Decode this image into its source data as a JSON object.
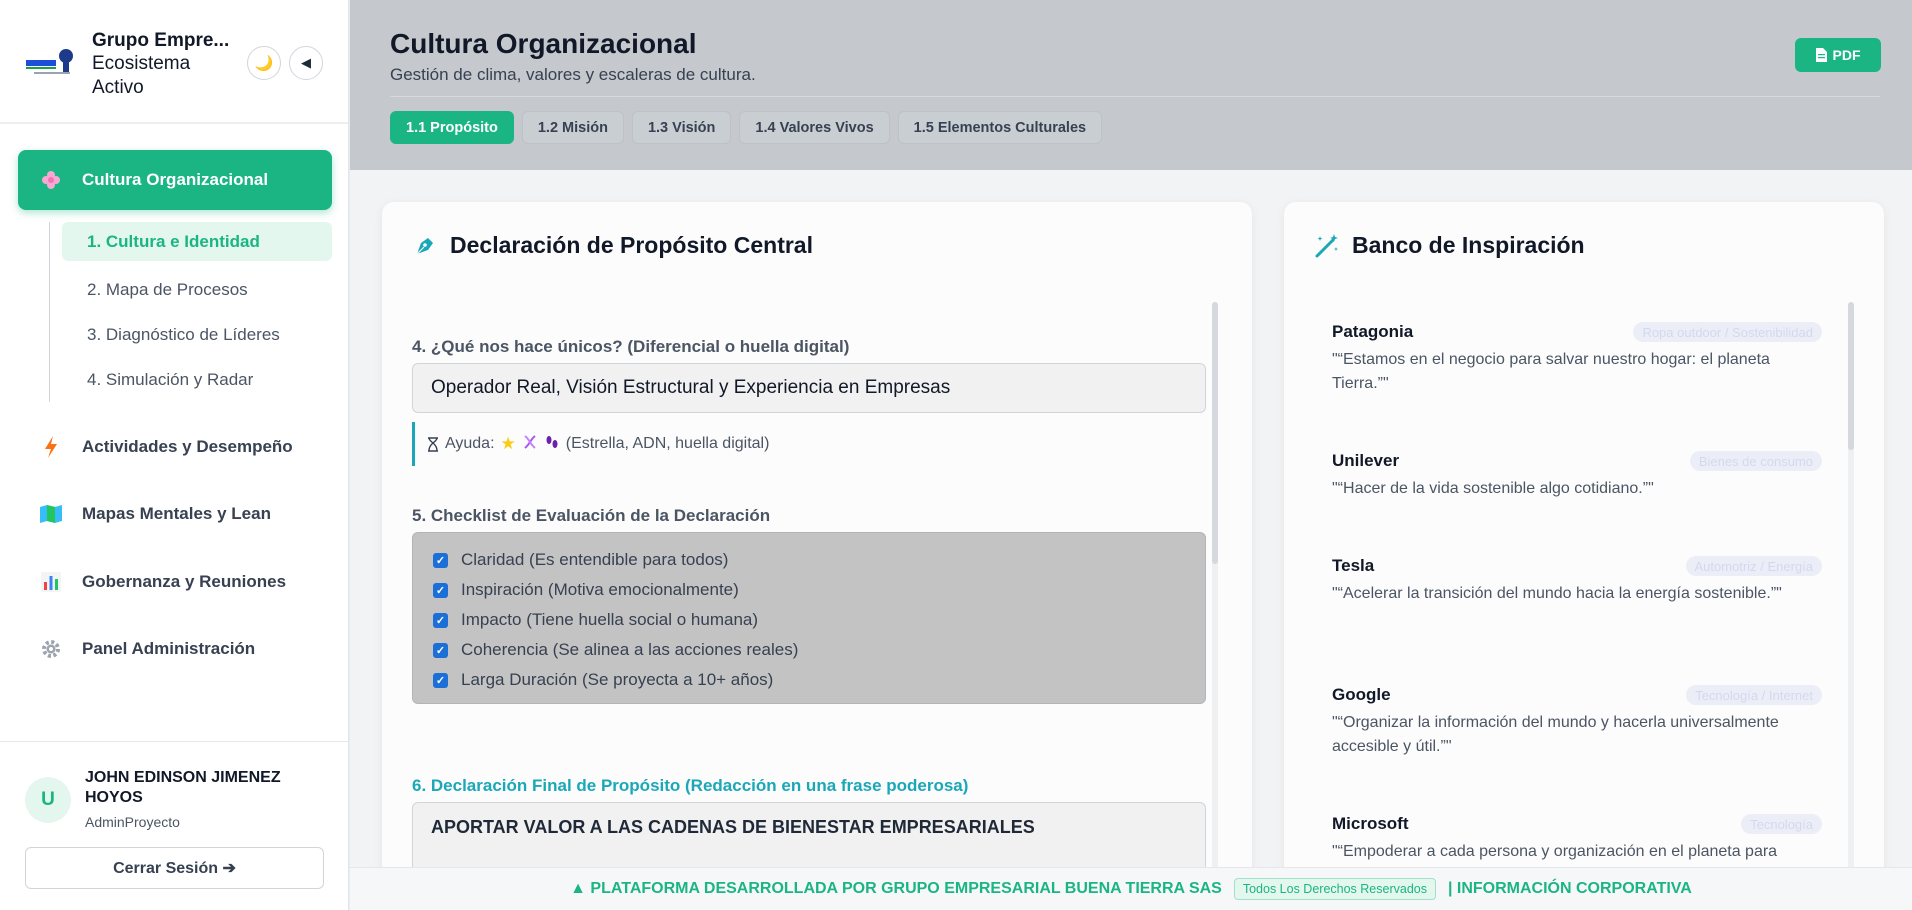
{
  "sidebar": {
    "brand_title": "Grupo Empre...",
    "brand_subtitle": "Ecosistema Activo",
    "theme_icon": "🌙",
    "collapse_icon": "◀",
    "main_item": "Cultura Organizacional",
    "sub_items": [
      "1. Cultura e Identidad",
      "2. Mapa de Procesos",
      "3. Diagnóstico de Líderes",
      "4. Simulación y Radar"
    ],
    "items": [
      {
        "label": "Actividades y Desempeño",
        "icon": "⚡"
      },
      {
        "label": "Mapas Mentales y Lean",
        "icon": "🗺"
      },
      {
        "label": "Gobernanza y Reuniones",
        "icon": "📊"
      },
      {
        "label": "Panel Administración",
        "icon": "⚙"
      }
    ],
    "user": {
      "initial": "U",
      "name": "JOHN EDINSON JIMENEZ HOYOS",
      "role": "AdminProyecto",
      "logout": "Cerrar Sesión ➔"
    }
  },
  "header": {
    "title": "Cultura Organizacional",
    "subtitle": "Gestión de clima, valores y escaleras de cultura.",
    "pdf_label": "PDF",
    "tabs": [
      "1.1 Propósito",
      "1.2 Misión",
      "1.3 Visión",
      "1.4 Valores Vivos",
      "1.5 Elementos Culturales"
    ]
  },
  "purpose": {
    "title": "Declaración de Propósito Central",
    "q4_label": "4. ¿Qué nos hace únicos? (Diferencial o huella digital)",
    "q4_value": "Operador Real, Visión Estructural y Experiencia en Empresas",
    "help_prefix": "Ayuda:",
    "help_text": "(Estrella, ADN, huella digital)",
    "q5_label": "5. Checklist de Evaluación de la Declaración",
    "checklist": [
      "Claridad (Es entendible para todos)",
      "Inspiración (Motiva emocionalmente)",
      "Impacto (Tiene huella social o humana)",
      "Coherencia (Se alinea a las acciones reales)",
      "Larga Duración (Se proyecta a 10+ años)"
    ],
    "q6_label": "6. Declaración Final de Propósito (Redacción en una frase poderosa)",
    "q6_value": "APORTAR VALOR A LAS CADENAS DE BIENESTAR EMPRESARIALES"
  },
  "inspiration": {
    "title": "Banco de Inspiración",
    "items": [
      {
        "name": "Patagonia",
        "tag": "Ropa outdoor / Sostenibilidad",
        "quote": "\"“Estamos en el negocio para salvar nuestro hogar: el planeta Tierra.”\""
      },
      {
        "name": "Unilever",
        "tag": "Bienes de consumo",
        "quote": "\"“Hacer de la vida sostenible algo cotidiano.”\""
      },
      {
        "name": "Tesla",
        "tag": "Automotriz / Energía",
        "quote": "\"“Acelerar la transición del mundo hacia la energía sostenible.”\""
      },
      {
        "name": "Google",
        "tag": "Tecnología / Internet",
        "quote": "\"“Organizar la información del mundo y hacerla universalmente accesible y útil.”\""
      },
      {
        "name": "Microsoft",
        "tag": "Tecnología",
        "quote": "\"“Empoderar a cada persona y organización en el planeta para"
      }
    ]
  },
  "footer": {
    "text": "▲ PLATAFORMA DESARROLLADA POR GRUPO EMPRESARIAL BUENA TIERRA SAS",
    "badge": "Todos Los Derechos Reservados",
    "link": "| INFORMACIÓN CORPORATIVA"
  }
}
